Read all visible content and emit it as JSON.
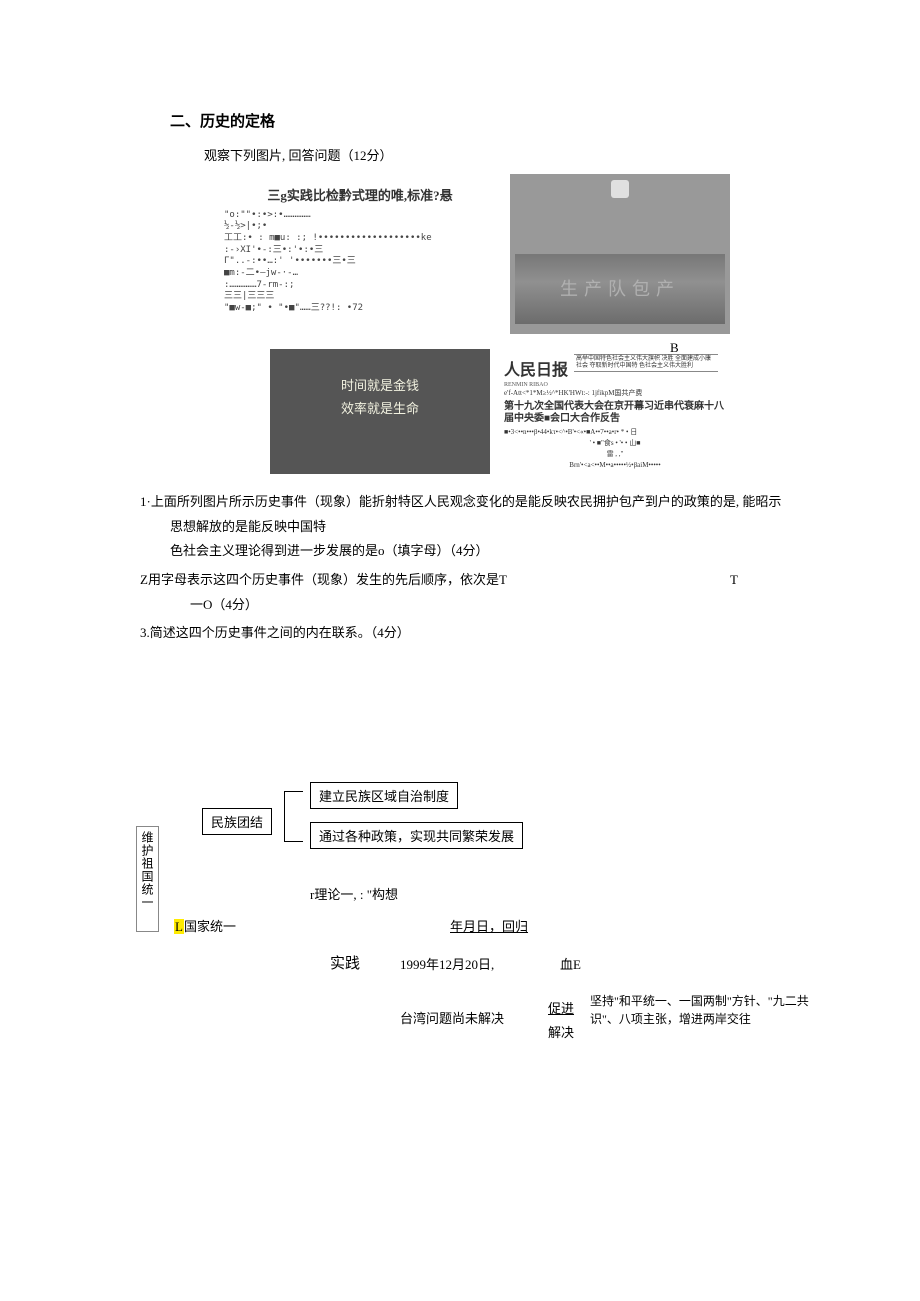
{
  "section": {
    "title": "二、历史的定格",
    "prompt": "观察下列图片, 回答问题（12分）"
  },
  "imgA": {
    "headline": "三g实践比检黔式理的唯,标准?悬",
    "garble": "\"o:\"\"•:•>:•……………\n      ½-½>|•;•\n工工:• :      m■u: :;              !•••••••••••••••••••ke\n:-›XI'•-:三•:'•:•三\nΓ\"..-:••…:' '•••••••三•三\n■m:-二•—jw-·-…\n:……………7-rm-:;\n三三|三三三\n\"■w-■;\"   • \"•■\"……三??!: •72"
  },
  "imgB": {
    "label": "B",
    "wall_text": "生产队包产"
  },
  "imgC": {
    "line1": "时间就是金钱",
    "line2": "效率就是生命"
  },
  "imgD": {
    "masthead": "人民日报",
    "masthead_sub": "RENMIN RIBAO",
    "mast_right": "高举中国特色社会主义伟大旗帜 决胜\n全面建成小康社会 夺取新时代中国特\n色社会主义伟大胜利",
    "garble_top": "e'f-Att<*1*M≥½^*HK'HWt:-: 1jfikpM国共产费",
    "headline": "第十九次全国代表大会在京开幕习近串代衰麻十八届中央委■会口大合作反吿",
    "garble1": "■•3<••n•••β•44•kτ•<^•B'•<«•■A••7••a•r• * • 日",
    "garble2": "'  • ■\"食s  • '• • 山■",
    "garble3": "雷 , ,\"",
    "garble4": "Brn'•<a<••M••a•••••½•βaiM•••••"
  },
  "q1": {
    "line1": "1·上面所列图片所示历史事件（现象）能折射特区人民观念变化的是能反映农民拥护包产到户的政策的是, 能昭示",
    "line2": "思想解放的是能反映中国特",
    "line3": "色社会主义理论得到进一步发展的是o（填字母）（4分）"
  },
  "q2": {
    "line1_left": "Z用字母表示这四个历史事件（现象）发生的先后顺序，依次是T",
    "line1_right": "T",
    "line2": "一O（4分）"
  },
  "q3": {
    "text": "3.简述这四个历史事件之间的内在联系。（4分）"
  },
  "diagram": {
    "vlabel": "维护祖国统一",
    "box_unity": "民族团结",
    "box_autonomy": "建立民族区域自治制度",
    "box_policy": "通过各种政策，实现共同繁荣发展",
    "theory_row": "r理论一, : \"构想",
    "nation_highlight": "L",
    "nation_unify": "国家统一",
    "return_label": "年月日，回归",
    "practice": "实践",
    "date": "1999年12月20日,",
    "blood": "血E",
    "taiwan": "台湾问题尚未解决",
    "promote": "促进",
    "solve": "解决",
    "promote_text": "坚持\"和平统一、一国两制\"方针、\"九二共识\"、八项主张，增进两岸交往"
  }
}
